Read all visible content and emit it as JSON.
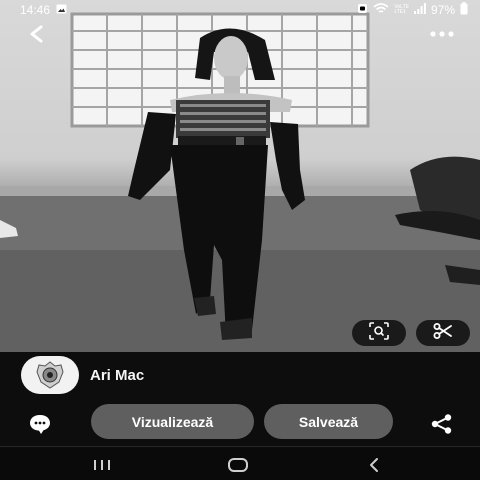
{
  "status_bar": {
    "time": "14:46",
    "network_label_top": "VoLTE",
    "network_label_bottom": "LTE1",
    "battery": "97%"
  },
  "pin": {
    "image_description_icon": "runway-model-photo",
    "author_name": "Ari Mac"
  },
  "actions": {
    "view_label": "Vizualizează",
    "save_label": "Salvează"
  },
  "colors": {
    "background": "#0d0d0d",
    "pill": "#5f5f5f",
    "icon_pill": "#1a1a1a"
  },
  "icons": {
    "back": "chevron-left-icon",
    "more": "more-horizontal-icon",
    "lens": "visual-search-icon",
    "cut": "scissors-icon",
    "comment": "comment-bubble-icon",
    "share": "share-icon",
    "recents": "recents-icon",
    "home": "home-icon",
    "system_back": "system-back-icon"
  }
}
